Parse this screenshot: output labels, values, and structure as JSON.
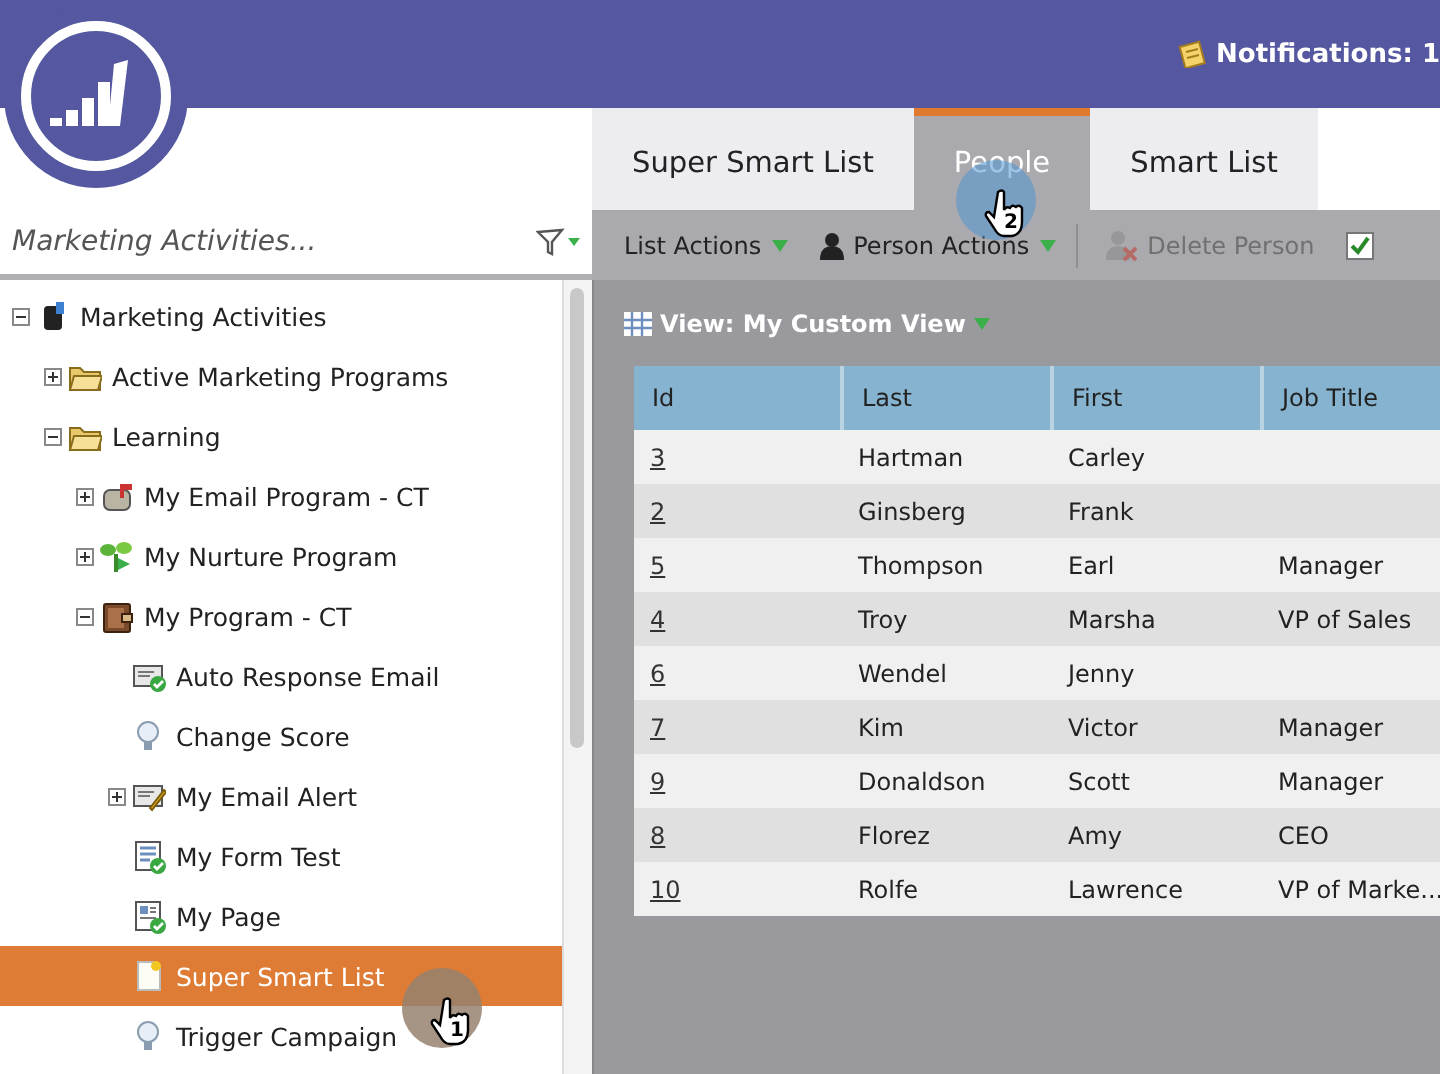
{
  "header": {
    "notifications": "Notifications: 1"
  },
  "tree_search": {
    "placeholder": "Marketing Activities..."
  },
  "tabs": [
    {
      "label": "Super Smart List",
      "selected": false
    },
    {
      "label": "People",
      "selected": true
    },
    {
      "label": "Smart List",
      "selected": false
    }
  ],
  "toolbar": [
    {
      "label": "List Actions",
      "kind": "menu",
      "disabled": false
    },
    {
      "label": "Person Actions",
      "kind": "person-menu",
      "disabled": false
    },
    {
      "label": "Delete Person",
      "kind": "delete",
      "disabled": true
    },
    {
      "kind": "approve",
      "disabled": false
    }
  ],
  "tree": [
    {
      "label": "Marketing Activities",
      "kind": "database",
      "expanded": true,
      "selected": false,
      "children": [
        {
          "label": "Active Marketing Programs",
          "kind": "folder",
          "expanded": false,
          "selected": false
        },
        {
          "label": "Learning",
          "kind": "folder",
          "expanded": true,
          "selected": false,
          "children": [
            {
              "label": "My Email Program - CT",
              "kind": "mailbox",
              "expanded": false,
              "selected": false
            },
            {
              "label": "My Nurture Program",
              "kind": "sprout",
              "expanded": false,
              "selected": false
            },
            {
              "label": "My Program - CT",
              "kind": "briefcase",
              "expanded": true,
              "selected": false,
              "children": [
                {
                  "label": "Auto Response Email",
                  "kind": "email",
                  "selected": false
                },
                {
                  "label": "Change Score",
                  "kind": "bulb",
                  "selected": false
                },
                {
                  "label": "My Email Alert",
                  "kind": "alert",
                  "expanded": false,
                  "selected": false
                },
                {
                  "label": "My Form Test",
                  "kind": "form",
                  "selected": false
                },
                {
                  "label": "My Page",
                  "kind": "page",
                  "selected": false
                },
                {
                  "label": "Super Smart List",
                  "kind": "list",
                  "selected": true
                },
                {
                  "label": "Trigger Campaign",
                  "kind": "bulb",
                  "selected": false
                }
              ]
            }
          ]
        }
      ]
    }
  ],
  "view": {
    "label": "View: My Custom View"
  },
  "table": {
    "columns": [
      "Id",
      "Last",
      "First",
      "Job Title"
    ],
    "rows": [
      [
        "3",
        "Hartman",
        "Carley",
        ""
      ],
      [
        "2",
        "Ginsberg",
        "Frank",
        ""
      ],
      [
        "5",
        "Thompson",
        "Earl",
        "Manager"
      ],
      [
        "4",
        "Troy",
        "Marsha",
        "VP of Sales"
      ],
      [
        "6",
        "Wendel",
        "Jenny",
        ""
      ],
      [
        "7",
        "Kim",
        "Victor",
        "Manager"
      ],
      [
        "9",
        "Donaldson",
        "Scott",
        "Manager"
      ],
      [
        "8",
        "Florez",
        "Amy",
        "CEO"
      ],
      [
        "10",
        "Rolfe",
        "Lawrence",
        "VP of Marke..."
      ]
    ]
  },
  "cursors": [
    {
      "label": "1"
    },
    {
      "label": "2"
    }
  ]
}
